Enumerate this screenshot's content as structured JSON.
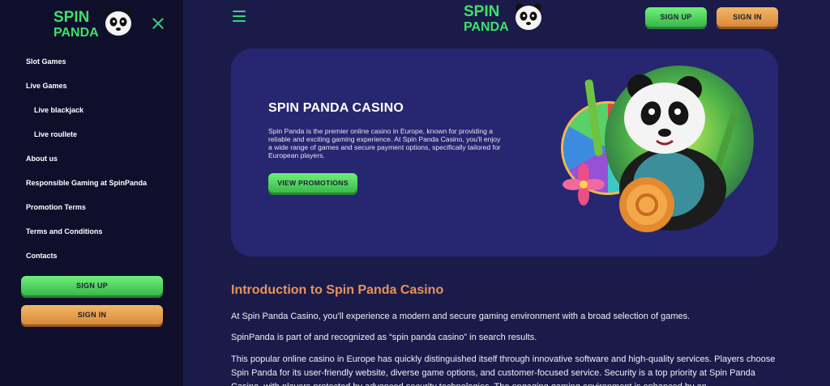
{
  "brand": {
    "line1": "SPIN",
    "line2": "PANDA"
  },
  "sidebar": {
    "items": [
      {
        "label": "Slot Games"
      },
      {
        "label": "Live Games"
      },
      {
        "label": "Live blackjack"
      },
      {
        "label": "Live roullete"
      },
      {
        "label": "About us"
      },
      {
        "label": "Responsible Gaming at SpinPanda"
      },
      {
        "label": "Promotion Terms"
      },
      {
        "label": "Terms and Conditions"
      },
      {
        "label": "Contacts"
      }
    ],
    "signup_label": "SIGN UP",
    "signin_label": "SIGN IN"
  },
  "header": {
    "signup_label": "SIGN UP",
    "signin_label": "SIGN IN"
  },
  "hero": {
    "title": "SPIN PANDA CASINO",
    "description": "Spin Panda is the premier online casino in Europe, known for providing a reliable and exciting gaming experience. At Spin Panda Casino, you'll enjoy a wide range of games and secure payment options, specifically tailored for European players.",
    "cta_label": "VIEW PROMOTIONS"
  },
  "article": {
    "title": "Introduction to Spin Panda Casino",
    "p1": "At Spin Panda Casino, you’ll experience a modern and secure gaming environment with a broad selection of games.",
    "p2": "SpinPanda is part of and recognized as “spin panda casino” in search results.",
    "p3": "This popular online casino in Europe has quickly distinguished itself through innovative software and high-quality services. Players choose Spin Panda for its user-friendly website, diverse game options, and customer-focused service. Security is a top priority at Spin Panda Casino, with players protected by advanced security technologies. The engaging gaming environment is enhanced by an"
  },
  "colors": {
    "accent_green": "#3ad37a",
    "accent_orange": "#e8935a",
    "background": "#1b1b4a",
    "hero": "#272670",
    "sidebar": "#0f0f2c"
  }
}
